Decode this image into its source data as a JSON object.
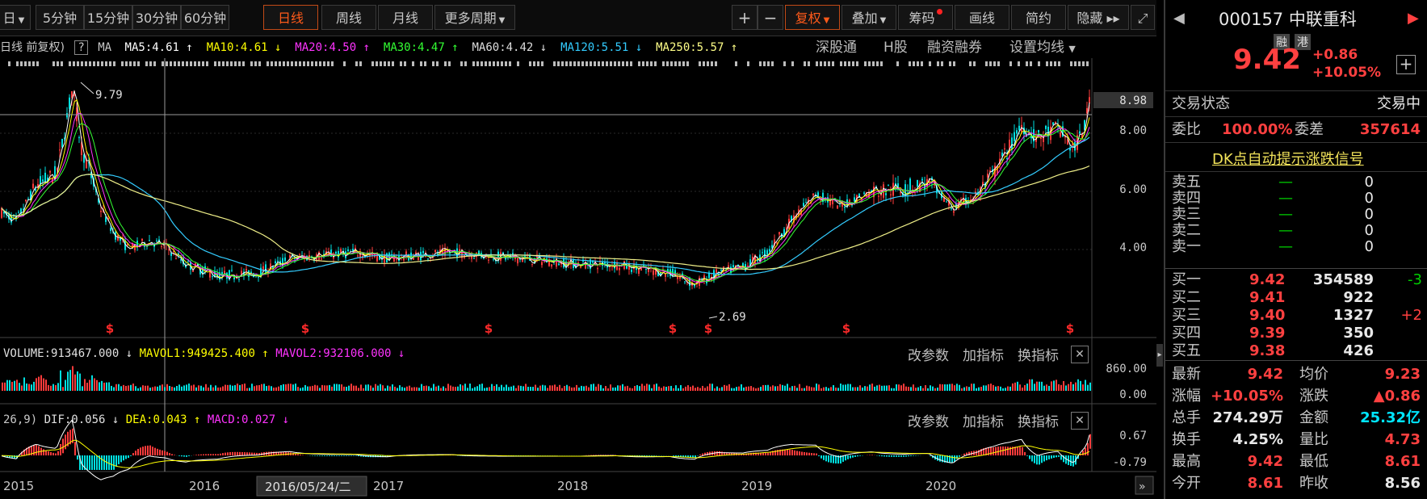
{
  "toolbar": {
    "items": [
      {
        "label": "日",
        "dropdown": true
      },
      {
        "label": "5分钟"
      },
      {
        "label": "15分钟"
      },
      {
        "label": "30分钟"
      },
      {
        "label": "60分钟"
      },
      {
        "label": "日线",
        "active": true
      },
      {
        "label": "周线"
      },
      {
        "label": "月线"
      },
      {
        "label": "更多周期",
        "dropdown": true
      }
    ],
    "tools": [
      {
        "label": "+"
      },
      {
        "label": "−"
      },
      {
        "label": "复权",
        "dropdown": true,
        "active": true
      },
      {
        "label": "叠加",
        "dropdown": true
      },
      {
        "label": "筹码",
        "dot": true
      },
      {
        "label": "画线"
      },
      {
        "label": "简约"
      },
      {
        "label": "隐藏 ▸▸"
      },
      {
        "label": "⤢"
      }
    ]
  },
  "ma_line": {
    "prefix": "日线 前复权)",
    "help": "?",
    "ma_label": "MA",
    "items": [
      {
        "text": "MA5:4.61",
        "arrow": "↑",
        "color": "#ffffff"
      },
      {
        "text": "MA10:4.61",
        "arrow": "↓",
        "color": "#ffff00"
      },
      {
        "text": "MA20:4.50",
        "arrow": "↑",
        "color": "#ff33ff"
      },
      {
        "text": "MA30:4.47",
        "arrow": "↑",
        "color": "#33ff33"
      },
      {
        "text": "MA60:4.42",
        "arrow": "↓",
        "color": "#dddddd"
      },
      {
        "text": "MA120:5.51",
        "arrow": "↓",
        "color": "#33ccff"
      },
      {
        "text": "MA250:5.57",
        "arrow": "↑",
        "color": "#ffff88"
      }
    ],
    "links": [
      "深股通",
      "H股",
      "融资融券",
      "设置均线"
    ]
  },
  "price_axis": [
    "8.98",
    "8.00",
    "6.00",
    "4.00"
  ],
  "annotations": {
    "high": "9.79",
    "low": "2.69"
  },
  "volume": {
    "label": "VOLUME:913467.000",
    "mavol1": "MAVOL1:949425.400",
    "mavol2": "MAVOL2:932106.000",
    "axis": [
      "860.00",
      "0.00"
    ]
  },
  "macd": {
    "prefix": "26,9)",
    "dif": "DIF:0.056",
    "dea": "DEA:0.043",
    "macd": "MACD:0.027",
    "axis": [
      "0.67",
      "-0.79"
    ]
  },
  "sub_links": [
    "改参数",
    "加指标",
    "换指标"
  ],
  "x_axis": {
    "labels": [
      "2015",
      "2016",
      "2017",
      "2018",
      "2019",
      "2020"
    ],
    "cursor_date": "2016/05/24/二"
  },
  "quote": {
    "code": "000157",
    "name": "中联重科",
    "badges": [
      "融",
      "港"
    ],
    "price": "9.42",
    "change": "+0.86",
    "pct": "+10.05%",
    "status_label": "交易状态",
    "status": "交易中",
    "weibi_label": "委比",
    "weibi": "100.00%",
    "weicha_label": "委差",
    "weicha": "357614",
    "dk_link": "DK点自动提示涨跌信号",
    "asks": [
      {
        "label": "卖五",
        "price": "—",
        "vol": "0"
      },
      {
        "label": "卖四",
        "price": "—",
        "vol": "0"
      },
      {
        "label": "卖三",
        "price": "—",
        "vol": "0"
      },
      {
        "label": "卖二",
        "price": "—",
        "vol": "0"
      },
      {
        "label": "卖一",
        "price": "—",
        "vol": "0"
      }
    ],
    "bids": [
      {
        "label": "买一",
        "price": "9.42",
        "vol": "354589",
        "chg": "-3"
      },
      {
        "label": "买二",
        "price": "9.41",
        "vol": "922",
        "chg": ""
      },
      {
        "label": "买三",
        "price": "9.40",
        "vol": "1327",
        "chg": "+2"
      },
      {
        "label": "买四",
        "price": "9.39",
        "vol": "350",
        "chg": ""
      },
      {
        "label": "买五",
        "price": "9.38",
        "vol": "426",
        "chg": ""
      }
    ],
    "stats": [
      {
        "l1": "最新",
        "v1": "9.42",
        "c1": "red",
        "l2": "均价",
        "v2": "9.23",
        "c2": "red"
      },
      {
        "l1": "涨幅",
        "v1": "+10.05%",
        "c1": "red",
        "l2": "涨跌",
        "v2": "▲0.86",
        "c2": "red"
      },
      {
        "l1": "总手",
        "v1": "274.29万",
        "c1": "white",
        "l2": "金额",
        "v2": "25.32亿",
        "c2": "cyan"
      },
      {
        "l1": "换手",
        "v1": "4.25%",
        "c1": "white",
        "l2": "量比",
        "v2": "4.73",
        "c2": "red"
      },
      {
        "l1": "最高",
        "v1": "9.42",
        "c1": "red",
        "l2": "最低",
        "v2": "8.61",
        "c2": "red"
      },
      {
        "l1": "今开",
        "v1": "8.61",
        "c1": "red",
        "l2": "昨收",
        "v2": "8.56",
        "c2": "white"
      }
    ]
  },
  "colors": {
    "up": "#ff3b3b",
    "down": "#00e0e0",
    "accent": "#ff5a1a"
  }
}
